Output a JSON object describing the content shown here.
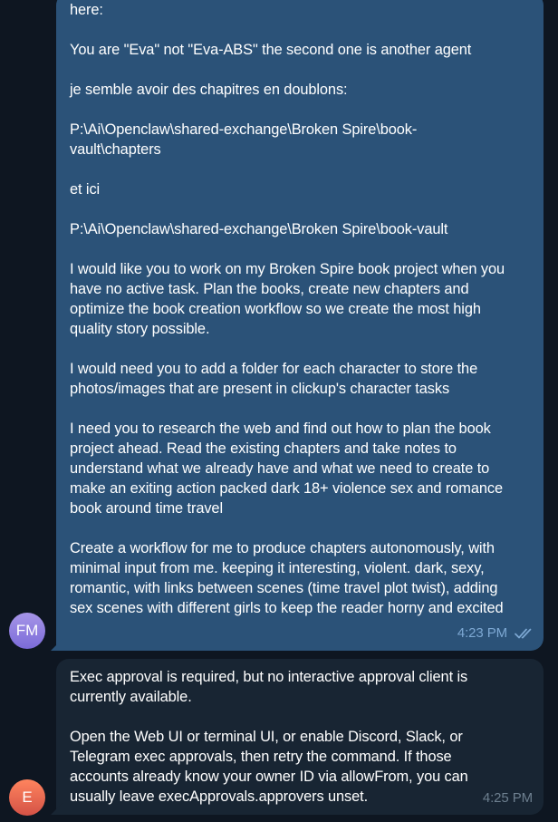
{
  "chat": {
    "messages": [
      {
        "sender_initials": "FM",
        "direction": "outgoing",
        "paragraphs": [
          "here:",
          "You are \"Eva\" not \"Eva-ABS\" the second one is another agent",
          "je semble avoir des chapitres en doublons:",
          "P:\\Ai\\Openclaw\\shared-exchange\\Broken Spire\\book-\nvault\\chapters",
          "et ici",
          "P:\\Ai\\Openclaw\\shared-exchange\\Broken Spire\\book-vault",
          "I would like you to work on my Broken Spire book project when you\nhave no active task. Plan the books, create new chapters and\noptimize the book creation workflow so we create the most high\nquality story possible.",
          "I would need you to add a folder for each character to store the\nphotos/images that are present in clickup's character tasks",
          "I need you to research the web and find out how to plan the book\nproject ahead. Read the existing chapters and take notes to\nunderstand what we already have and what we need to create to\nmake an exiting action packed dark 18+ violence sex and romance\nbook around time travel",
          "Create a workflow for me to produce chapters autonomously, with\nminimal input from me. keeping it interesting, violent. dark, sexy,\nromantic, with links between scenes (time travel plot twist), adding\nsex scenes with different girls to keep the reader horny and excited"
        ],
        "time": "4:23 PM",
        "status": "read"
      },
      {
        "sender_initials": "E",
        "direction": "incoming",
        "paragraphs": [
          "Exec approval is required, but no interactive approval client is\ncurrently available.",
          "Open the Web UI or terminal UI, or enable Discord, Slack, or\nTelegram exec approvals, then retry the command. If those\naccounts already know your owner ID via allowFrom, you can\nusually leave execApprovals.approvers unset."
        ],
        "time": "4:25 PM"
      }
    ]
  },
  "colors": {
    "background": "#0e1621",
    "outgoing_bubble": "#2b5278",
    "incoming_bubble": "#182533",
    "outgoing_meta": "#7da8d3",
    "incoming_meta": "#6d7f8f",
    "read_check": "#7da8d3"
  },
  "icons": {
    "read_receipt": "double-check-icon"
  }
}
